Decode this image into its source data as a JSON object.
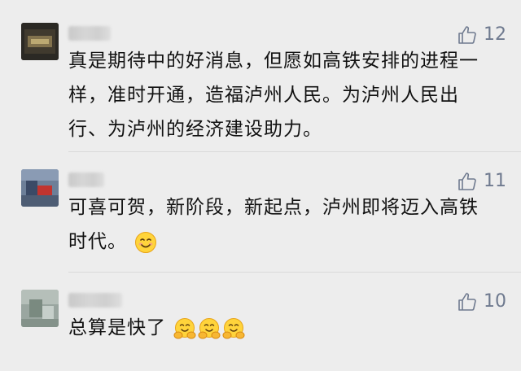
{
  "comments": [
    {
      "likes": "12",
      "lines": [
        "真是期待中的好消息，但愿如高铁安排的进程一",
        "样，准时开通，造福泸州人民。为泸州人民出",
        "行、为泸州的经济建设助力。"
      ]
    },
    {
      "likes": "11",
      "lines": [
        "可喜可贺，新阶段，新起点，泸州即将迈入高铁",
        "时代。"
      ],
      "trailing_emoji": "smiling-face-emoji"
    },
    {
      "likes": "10",
      "lines": [
        "总算是快了"
      ],
      "trailing_emoji": "hugging-face-emoji ×3"
    }
  ],
  "colors": {
    "like_icon": "#6f7a8f",
    "text": "#111111",
    "background": "#ededed"
  }
}
